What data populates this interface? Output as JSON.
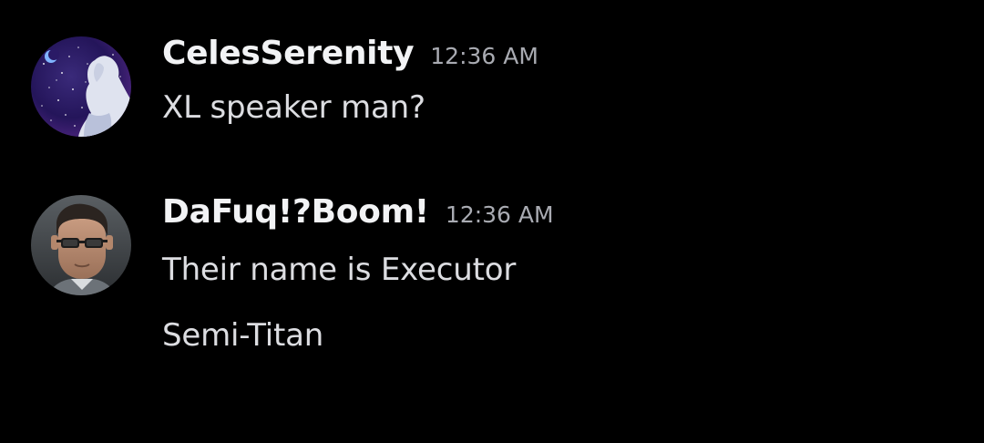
{
  "colors": {
    "background": "#000000",
    "username": "#f2f3f5",
    "timestamp": "#a9abb2",
    "message_text": "#dcdde1"
  },
  "messages": [
    {
      "username": "CelesSerenity",
      "timestamp": "12:36 AM",
      "avatar_icon": "anime-avatar-night-sky",
      "lines": [
        "XL speaker man?"
      ]
    },
    {
      "username": "DaFuq!?Boom!",
      "timestamp": "12:36 AM",
      "avatar_icon": "man-with-glasses-avatar",
      "lines": [
        "Their name is Executor",
        "Semi-Titan"
      ]
    }
  ]
}
